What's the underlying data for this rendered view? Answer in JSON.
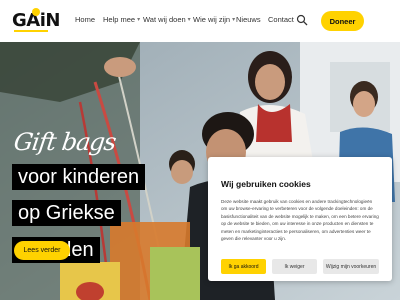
{
  "brand": {
    "logo_text": "GAiN",
    "accent": "#ffd200"
  },
  "nav": {
    "home": "Home",
    "help": "Help mee",
    "wat": "Wat wij doen",
    "wie": "Wie wij zijn",
    "nieuws": "Nieuws",
    "contact": "Contact",
    "search_icon": "search-icon",
    "donate": "Doneer"
  },
  "hero": {
    "script_line": "Gift bags",
    "line1": "voor kinderen",
    "line2": "op Griekse",
    "line3": "eilanden",
    "cta": "Lees verder"
  },
  "cookie": {
    "title": "Wij gebruiken cookies",
    "body": "Deze website maakt gebruik van cookies en andere trackingtechnologieën om uw browse-ervaring te verbeteren voor de volgende doeleinden: om de basisfunctionaliteit van de website mogelijk te maken, om een betere ervaring op de website te bieden, om uw interesse in onze producten en diensten te meten en marketinginteracties te personaliseren, om advertenties weer te geven die relevanter voor u zijn.",
    "accept": "Ik ga akkoord",
    "reject": "Ik weiger",
    "preferences": "Wijzig mijn voorkeuren"
  }
}
